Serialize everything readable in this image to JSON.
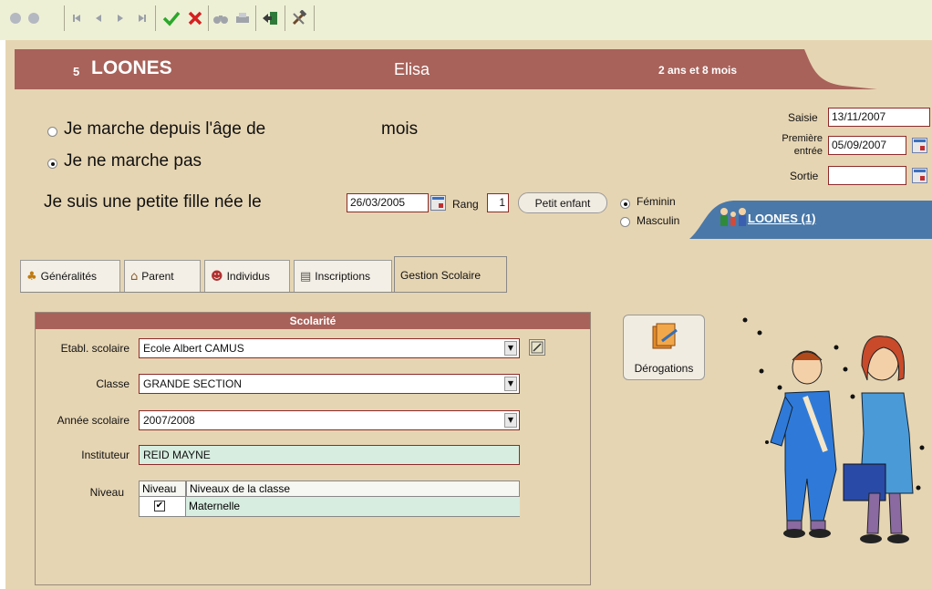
{
  "toolbar": {
    "buttons": [
      "circle-icon",
      "circle-icon",
      "first-icon",
      "prev-icon",
      "next-icon",
      "last-icon",
      "check-icon",
      "cross-icon",
      "binoculars-icon",
      "print-icon",
      "exit-icon",
      "tools-icon"
    ],
    "glyphs": {
      "first": "⏮",
      "prev": "◀",
      "next": "▶",
      "last": "⏭",
      "check": "✔",
      "cross": "✖",
      "binoculars": "👓",
      "print": "🖶",
      "exit": "⇥",
      "tools": "🔨"
    }
  },
  "header": {
    "number": "5",
    "lastname": "LOONES",
    "firstname": "Elisa",
    "age": "2 ans et 8 mois"
  },
  "walking": {
    "option1": "Je marche depuis l'âge de",
    "option1_unit": "mois",
    "option2": "Je ne marche pas",
    "selected": "option2"
  },
  "dates": {
    "saisie_label": "Saisie",
    "saisie_value": "13/11/2007",
    "premiere_label_1": "Première",
    "premiere_label_2": "entrée",
    "premiere_value": "05/09/2007",
    "sortie_label": "Sortie",
    "sortie_value": ""
  },
  "birth": {
    "label": "Je suis une petite fille née le",
    "date": "26/03/2005",
    "rang_label": "Rang",
    "rang_value": "1",
    "petit_enfant_label": "Petit enfant",
    "feminin_label": "Féminin",
    "masculin_label": "Masculin",
    "selected_gender": "feminin"
  },
  "family_link": "LOONES (1)",
  "tabs": [
    {
      "label": "Généralités",
      "icon": "person-icon",
      "glyph": "♣"
    },
    {
      "label": "Parent",
      "icon": "house-icon",
      "glyph": "⌂"
    },
    {
      "label": "Individus",
      "icon": "people-icon",
      "glyph": "☻"
    },
    {
      "label": "Inscriptions",
      "icon": "clipboard-icon",
      "glyph": "▤"
    },
    {
      "label": "Gestion Scolaire",
      "icon": "",
      "glyph": ""
    }
  ],
  "active_tab": 4,
  "scolarite": {
    "title": "Scolarité",
    "etabl_label": "Etabl. scolaire",
    "etabl_value": "Ecole Albert CAMUS",
    "classe_label": "Classe",
    "classe_value": "GRANDE SECTION",
    "annee_label": "Année scolaire",
    "annee_value": "2007/2008",
    "instituteur_label": "Instituteur",
    "instituteur_value": "REID MAYNE",
    "niveau_label": "Niveau",
    "grid_headers": [
      "Niveau",
      "Niveaux de la classe"
    ],
    "grid_rows": [
      {
        "checked": true,
        "name": "Maternelle"
      }
    ]
  },
  "derogations_label": "Dérogations",
  "colors": {
    "band": "#a8625a",
    "panel": "#e6d5b3",
    "toolbar": "#eef0d6",
    "family_band": "#4a78a8",
    "field_border": "#8c2a2a"
  }
}
